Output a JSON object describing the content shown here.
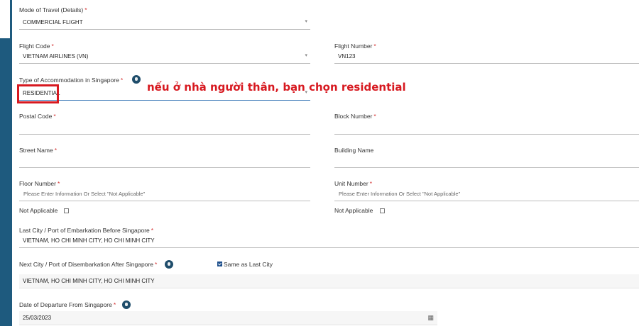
{
  "form": {
    "mode_of_travel": {
      "label": "Mode of Travel (Details)",
      "required": "*",
      "value": "COMMERCIAL FLIGHT"
    },
    "flight_code": {
      "label": "Flight Code",
      "required": "*",
      "value": "VIETNAM AIRLINES (VN)"
    },
    "flight_number": {
      "label": "Flight Number",
      "required": "*",
      "value": "VN123"
    },
    "accommodation_type": {
      "label": "Type of Accommodation in Singapore",
      "required": "*",
      "value": "RESIDENTIAL"
    },
    "postal_code": {
      "label": "Postal Code",
      "required": "*",
      "value": ""
    },
    "block_number": {
      "label": "Block Number",
      "required": "*",
      "value": ""
    },
    "street_name": {
      "label": "Street Name",
      "required": "*",
      "value": ""
    },
    "building_name": {
      "label": "Building Name",
      "value": ""
    },
    "floor_number": {
      "label": "Floor Number",
      "required": "*",
      "placeholder": "Please Enter Information Or Select \"Not Applicable\""
    },
    "unit_number": {
      "label": "Unit Number",
      "required": "*",
      "placeholder": "Please Enter Information Or Select \"Not Applicable\""
    },
    "floor_not_applicable": {
      "label": "Not Applicable",
      "checked": false
    },
    "unit_not_applicable": {
      "label": "Not Applicable",
      "checked": false
    },
    "last_city": {
      "label": "Last City / Port of Embarkation Before Singapore",
      "required": "*",
      "value": "VIETNAM, HO CHI MINH CITY, HO CHI MINH CITY"
    },
    "next_city": {
      "label": "Next City / Port of Disembarkation After Singapore",
      "required": "*",
      "value": "VIETNAM, HO CHI MINH CITY, HO CHI MINH CITY"
    },
    "same_as_last_city": {
      "label": "Same as Last City",
      "checked": true
    },
    "departure_date": {
      "label": "Date of Departure From Singapore",
      "required": "*",
      "value": "25/03/2023"
    }
  },
  "icons": {
    "dropdown": "caret-down-icon",
    "info": "info-icon",
    "calendar": "calendar-icon"
  },
  "annotation": {
    "text": "nếu ở nhà người thân, bạn chọn residential",
    "color": "#d71920"
  },
  "colors": {
    "sidebar": "#1e5a7e",
    "required": "#d32f2f",
    "info_icon": "#1f4d6b"
  }
}
